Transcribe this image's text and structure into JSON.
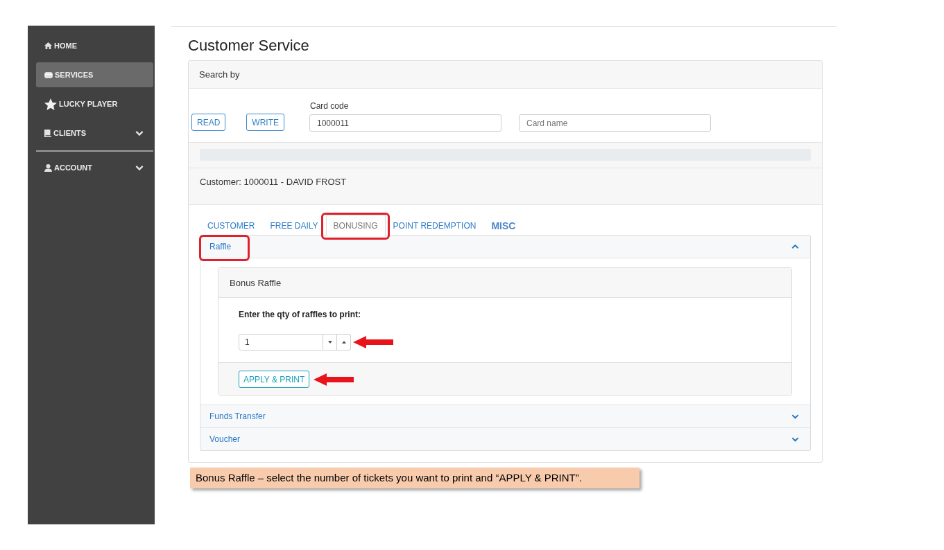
{
  "sidebar": {
    "sections": [
      {
        "items": [
          {
            "label": "HOME",
            "kind": "link",
            "selected": false
          },
          {
            "label": "SERVICES",
            "kind": "link",
            "selected": true
          },
          {
            "label": "LUCKY PLAYER",
            "kind": "link",
            "selected": false
          },
          {
            "label": "CLIENTS",
            "kind": "group",
            "selected": false,
            "expanded": false
          }
        ]
      },
      {
        "items": [
          {
            "label": "ACCOUNT",
            "kind": "group",
            "selected": false,
            "expanded": false
          }
        ]
      }
    ]
  },
  "page": {
    "title": "Customer Service"
  },
  "search": {
    "title": "Search by",
    "buttons": [
      "READ",
      "WRITE"
    ],
    "card_code": {
      "label": "Card code",
      "value": "1000011"
    },
    "card_name": {
      "placeholder": "Card name"
    }
  },
  "customer": {
    "header": "Customer: 1000011 - DAVID FROST",
    "tabs": [
      {
        "label": "CUSTOMER",
        "kind": "plain",
        "selected": false,
        "highlighted": false
      },
      {
        "label": "FREE DAILY",
        "kind": "plain",
        "selected": false,
        "highlighted": false
      },
      {
        "label": "BONUSING",
        "kind": "plain",
        "selected": true,
        "highlighted": true
      },
      {
        "label": "POINT REDEMPTION",
        "kind": "plain",
        "selected": false,
        "highlighted": false
      },
      {
        "label": "MISC",
        "kind": "strong",
        "selected": false,
        "highlighted": false
      }
    ],
    "accordion": [
      {
        "title": "Raffle",
        "expanded": true,
        "highlighted": true,
        "panel": {
          "title": "Bonus Raffle",
          "prompt": "Enter the qty of raffles to print:",
          "quantity": {
            "value": "1",
            "pointed": true
          },
          "button": {
            "label": "APPLY & PRINT",
            "pointed": true
          }
        }
      },
      {
        "title": "Funds Transfer",
        "expanded": false,
        "highlighted": false
      },
      {
        "title": "Voucher",
        "expanded": false,
        "highlighted": false
      }
    ]
  },
  "note": "Bonus Raffle – select the number of tickets you want to print and “APPLY & PRINT”."
}
